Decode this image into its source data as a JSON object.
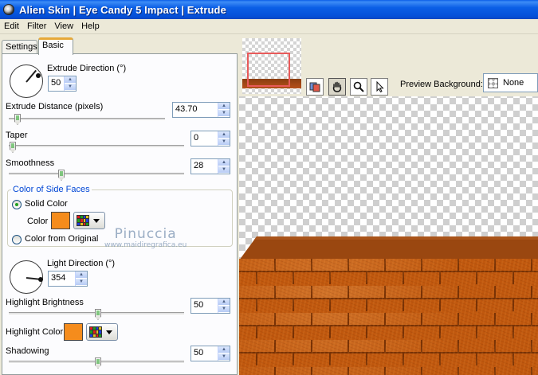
{
  "window": {
    "title": "Alien Skin  |  Eye Candy 5 Impact  |  Extrude"
  },
  "menu": [
    "Edit",
    "Filter",
    "View",
    "Help"
  ],
  "tabs": {
    "settings": "Settings",
    "basic": "Basic"
  },
  "basic": {
    "extrude_direction": {
      "label": "Extrude Direction (°)",
      "value": "50"
    },
    "extrude_distance": {
      "label": "Extrude Distance (pixels)",
      "value": "43.70",
      "slider_fraction": 0.07
    },
    "taper": {
      "label": "Taper",
      "value": "0",
      "slider_fraction": 0.0
    },
    "smoothness": {
      "label": "Smoothness",
      "value": "28",
      "slider_fraction": 0.28
    },
    "side_faces": {
      "group_label": "Color of Side Faces",
      "solid_color": "Solid Color",
      "color_label": "Color",
      "from_original": "Color from Original",
      "selected": "solid",
      "swatch_color": "#f58c1c"
    },
    "light_direction": {
      "label": "Light Direction (°)",
      "value": "354"
    },
    "highlight_brightness": {
      "label": "Highlight Brightness",
      "value": "50",
      "slider_fraction": 0.5
    },
    "highlight_color": {
      "label": "Highlight Color",
      "swatch_color": "#f58c1c"
    },
    "shadowing": {
      "label": "Shadowing",
      "value": "50",
      "slider_fraction": 0.5
    }
  },
  "watermark": {
    "name": "Pinuccia",
    "url": "www.maidiregrafica.eu"
  },
  "preview": {
    "background_label": "Preview Background:",
    "background_value": "None",
    "tools": [
      "compare-icon",
      "hand-icon",
      "zoom-icon",
      "pointer-icon"
    ]
  }
}
